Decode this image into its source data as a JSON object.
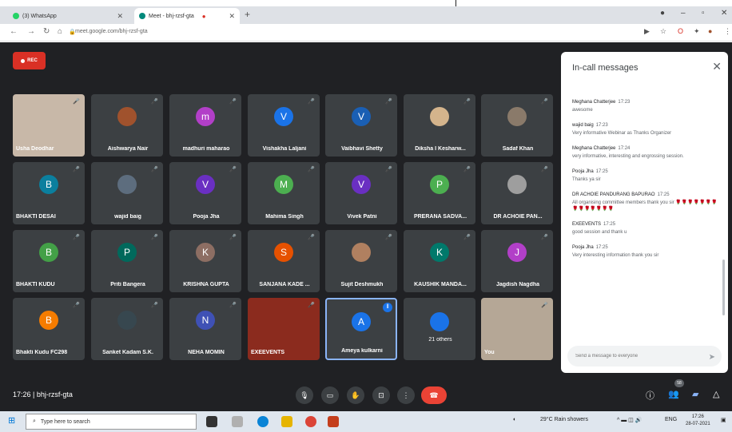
{
  "browser": {
    "tabs": [
      {
        "title": "(3) WhatsApp",
        "close": "✕"
      },
      {
        "title": "Meet - bhj-rzsf-gta",
        "close": "✕"
      }
    ],
    "new_tab": "+",
    "url": "meet.google.com/bhj-rzsf-gta"
  },
  "meet": {
    "rec_label": "REC",
    "tiles": [
      {
        "name": "Usha Deodhar",
        "type": "video"
      },
      {
        "name": "Aishwarya Nair",
        "type": "photo",
        "color": "#a0522d"
      },
      {
        "name": "madhuri maharao",
        "type": "letter",
        "letter": "m",
        "color": "#b23fc8"
      },
      {
        "name": "Vishakha Laljani",
        "type": "letter",
        "letter": "V",
        "color": "#1a73e8"
      },
      {
        "name": "Vaibhavi Shetty",
        "type": "letter",
        "letter": "V",
        "color": "#1a5fb4"
      },
      {
        "name": "Diksha I Kesharw...",
        "type": "photo",
        "color": "#d4b48c"
      },
      {
        "name": "Sadaf Khan",
        "type": "photo",
        "color": "#8a7a6a"
      },
      {
        "name": "BHAKTI DESAI",
        "type": "letter",
        "letter": "B",
        "color": "#0b7f9e"
      },
      {
        "name": "wajid baig",
        "type": "photo",
        "color": "#5d6d7e"
      },
      {
        "name": "Pooja Jha",
        "type": "letter",
        "letter": "V",
        "color": "#6a2fc2"
      },
      {
        "name": "Mahima Singh",
        "type": "letter",
        "letter": "M",
        "color": "#4caf50"
      },
      {
        "name": "Vivek Patni",
        "type": "letter",
        "letter": "V",
        "color": "#6a2fc2"
      },
      {
        "name": "PRERANA SADVA...",
        "type": "letter",
        "letter": "P",
        "color": "#4caf50"
      },
      {
        "name": "DR ACHOIE PAN...",
        "type": "photo",
        "color": "#9e9e9e"
      },
      {
        "name": "BHAKTI KUDU",
        "type": "letter",
        "letter": "B",
        "color": "#43a047"
      },
      {
        "name": "Priti Bangera",
        "type": "letter",
        "letter": "P",
        "color": "#00695c"
      },
      {
        "name": "KRISHNA GUPTA",
        "type": "letter",
        "letter": "K",
        "color": "#8d6e63"
      },
      {
        "name": "SANJANA KADE ...",
        "type": "letter",
        "letter": "S",
        "color": "#e65100"
      },
      {
        "name": "Sujit Deshmukh",
        "type": "photo",
        "color": "#b08060"
      },
      {
        "name": "KAUSHIK MANDA...",
        "type": "letter",
        "letter": "K",
        "color": "#00796b"
      },
      {
        "name": "Jagdish Nagdha",
        "type": "letter",
        "letter": "J",
        "color": "#b23fc8"
      },
      {
        "name": "Bhakti Kudu FC298",
        "type": "letter",
        "letter": "B",
        "color": "#f57c00"
      },
      {
        "name": "Sanket Kadam S.K.",
        "type": "photo",
        "color": "#37474f"
      },
      {
        "name": "NEHA MOMIN",
        "type": "letter",
        "letter": "N",
        "color": "#3f51b5"
      },
      {
        "name": "EXEEVENTS",
        "type": "video"
      },
      {
        "name": "Ameya kulkarni",
        "type": "letter",
        "letter": "A",
        "color": "#1a73e8"
      },
      {
        "name": "21 others",
        "type": "others"
      },
      {
        "name": "You",
        "type": "video"
      }
    ],
    "panel": {
      "title": "In-call messages",
      "messages": [
        {
          "from": "Meghana Chatterjee",
          "time": "17:23",
          "text": "awesome"
        },
        {
          "from": "wajid baig",
          "time": "17:23",
          "text": "Very informative Webinar as Thanks Organizer"
        },
        {
          "from": "Meghana Chatterjee",
          "time": "17:24",
          "text": "very informative, interesting and engrossing session."
        },
        {
          "from": "Pooja Jha",
          "time": "17:25",
          "text": "Thanks ya sir"
        },
        {
          "from": "DR ACHOIE PANDURANG BAPURAO",
          "time": "17:25",
          "text": "All organising committee members thank you sir 🌹🌹🌹🌹🌹🌹🌹🌹🌹🌹🌹🌹🌹🌹"
        },
        {
          "from": "EXEEVENTS",
          "time": "17:25",
          "text": "good session and thank u"
        },
        {
          "from": "Pooja Jha",
          "time": "17:25",
          "text": "Very interesting information thank you sir"
        }
      ],
      "input_placeholder": "Send a message to everyone"
    },
    "bottom": {
      "time": "17:26",
      "meeting_code": "bhj-rzsf-gta",
      "people_count": "58"
    }
  },
  "taskbar": {
    "search_placeholder": "Type here to search",
    "weather": "29°C  Rain showers",
    "lang": "ENG",
    "clock_time": "17:26",
    "clock_date": "28-07-2021"
  }
}
